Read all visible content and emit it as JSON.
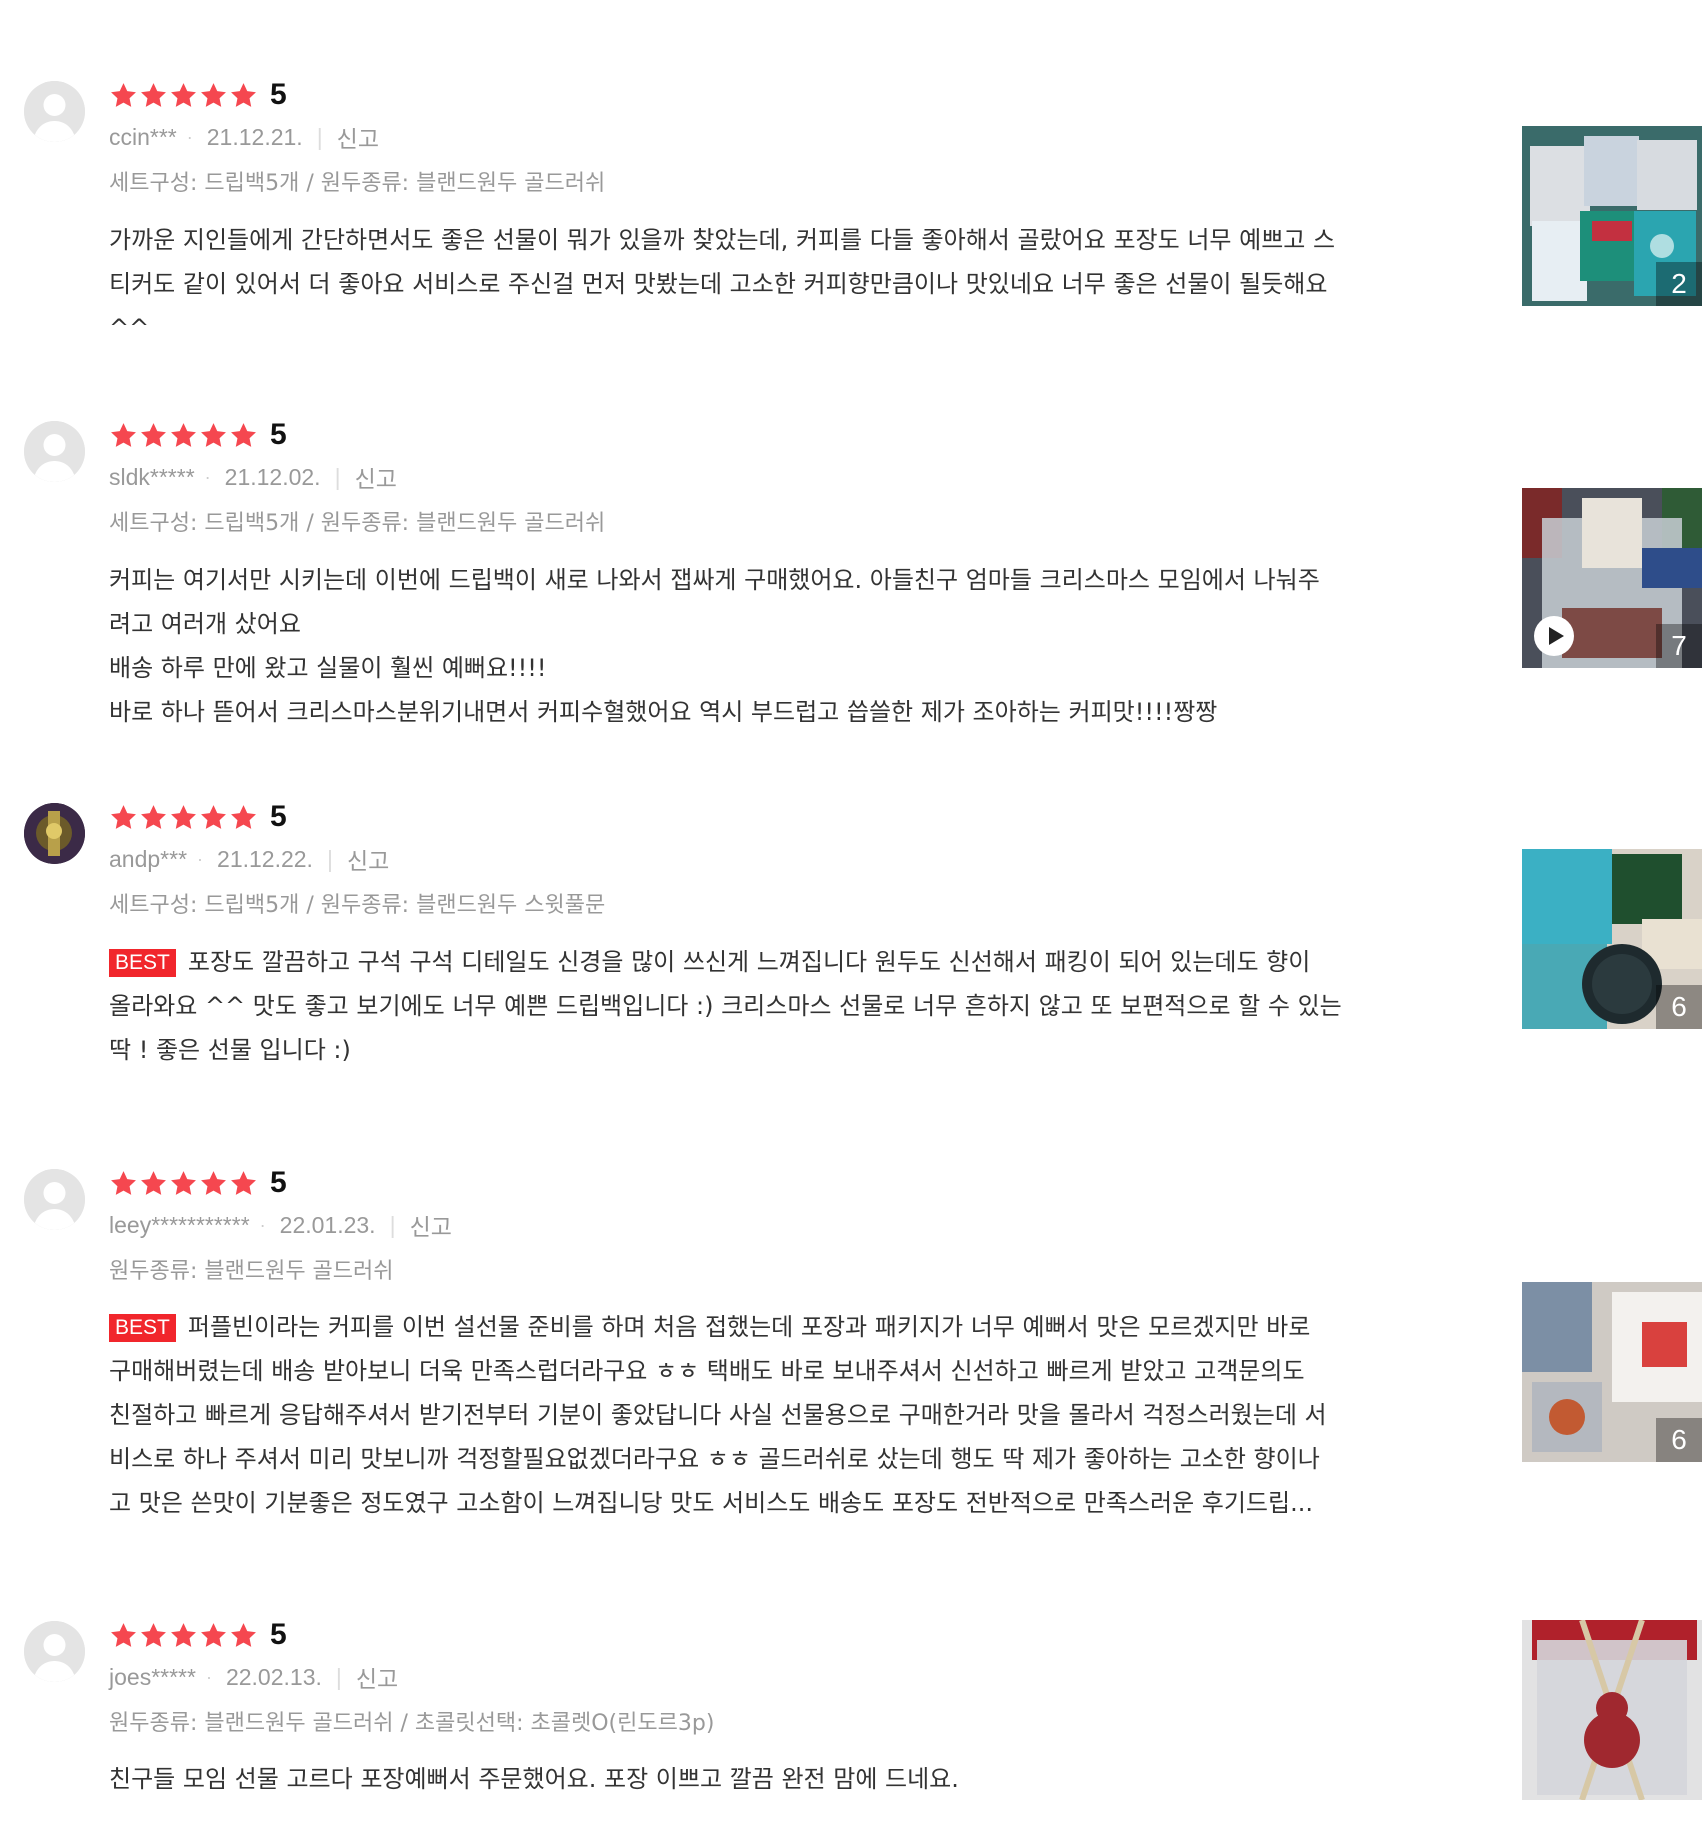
{
  "colors": {
    "star": "#f5474f",
    "best": "#f1262c",
    "meta": "#999999",
    "text": "#333333"
  },
  "report_label": "신고",
  "best_label": "BEST",
  "reviews": [
    {
      "rating": "5",
      "user": "ccin***",
      "date": "21.12.21.",
      "option": "세트구성: 드립백5개 / 원두종류: 블랜드원두 골드러쉬",
      "best": false,
      "lines": [
        "가까운 지인들에게 간단하면서도 좋은 선물이 뭐가 있을까 찾았는데, 커피를 다들 좋아해서 골랐어요 포장도 너무 예쁘고 스",
        "티커도 같이 있어서 더 좋아요 서비스로 주신걸 먼저 맛봤는데 고소한 커피향만큼이나 맛있네요 너무 좋은 선물이 될듯해요",
        "^^"
      ],
      "photo_count": "2",
      "video": false
    },
    {
      "rating": "5",
      "user": "sldk*****",
      "date": "21.12.02.",
      "option": "세트구성: 드립백5개 / 원두종류: 블랜드원두 골드러쉬",
      "best": false,
      "lines": [
        "커피는 여기서만 시키는데 이번에 드립백이 새로 나와서 잽싸게 구매했어요. 아들친구 엄마들 크리스마스 모임에서 나눠주",
        "려고 여러개 샀어요",
        "배송 하루 만에 왔고 실물이 훨씬 예뻐요!!!!",
        "바로 하나 뜯어서 크리스마스분위기내면서 커피수혈했어요 역시 부드럽고 씁쓸한 제가 조아하는 커피맛!!!!짱짱"
      ],
      "photo_count": "7",
      "video": true
    },
    {
      "rating": "5",
      "user": "andp***",
      "date": "21.12.22.",
      "option": "세트구성: 드립백5개 / 원두종류: 블랜드원두 스윗풀문",
      "best": true,
      "lines": [
        "포장도 깔끔하고 구석 구석 디테일도 신경을 많이 쓰신게 느껴집니다 원두도 신선해서 패킹이 되어 있는데도 향이",
        "올라와요 ^^ 맛도 좋고 보기에도 너무 예쁜 드립백입니다 :) 크리스마스 선물로 너무 흔하지 않고 또 보편적으로 할 수 있는",
        "딱 ! 좋은 선물 입니다 :)"
      ],
      "photo_count": "6",
      "video": false
    },
    {
      "rating": "5",
      "user": "leey***********",
      "date": "22.01.23.",
      "option": "원두종류: 블랜드원두 골드러쉬",
      "best": true,
      "lines": [
        "퍼플빈이라는 커피를 이번 설선물 준비를 하며 처음 접했는데 포장과 패키지가 너무 예뻐서 맛은 모르겠지만 바로",
        "구매해버렸는데 배송 받아보니 더욱 만족스럽더라구요 ㅎㅎ 택배도 바로 보내주셔서 신선하고 빠르게 받았고 고객문의도",
        "친절하고 빠르게 응답해주셔서 받기전부터 기분이 좋았답니다 사실 선물용으로 구매한거라 맛을 몰라서 걱정스러웠는데 서",
        "비스로 하나 주셔서 미리 맛보니까 걱정할필요없겠더라구요 ㅎㅎ 골드러쉬로 샀는데 행도 딱 제가 좋아하는 고소한 향이나",
        "고 맛은 쓴맛이 기분좋은 정도였구 고소함이 느껴집니당 맛도 서비스도 배송도 포장도 전반적으로 만족스러운 후기드립..."
      ],
      "photo_count": "6",
      "video": false
    },
    {
      "rating": "5",
      "user": "joes*****",
      "date": "22.02.13.",
      "option": "원두종류: 블랜드원두 골드러쉬 / 초콜릿선택: 초콜렛O(린도르3p)",
      "best": false,
      "lines": [
        "친구들 모임 선물 고르다 포장예뻐서 주문했어요. 포장 이쁘고 깔끔 완전 맘에 드네요."
      ],
      "photo_count": "",
      "video": false
    }
  ]
}
